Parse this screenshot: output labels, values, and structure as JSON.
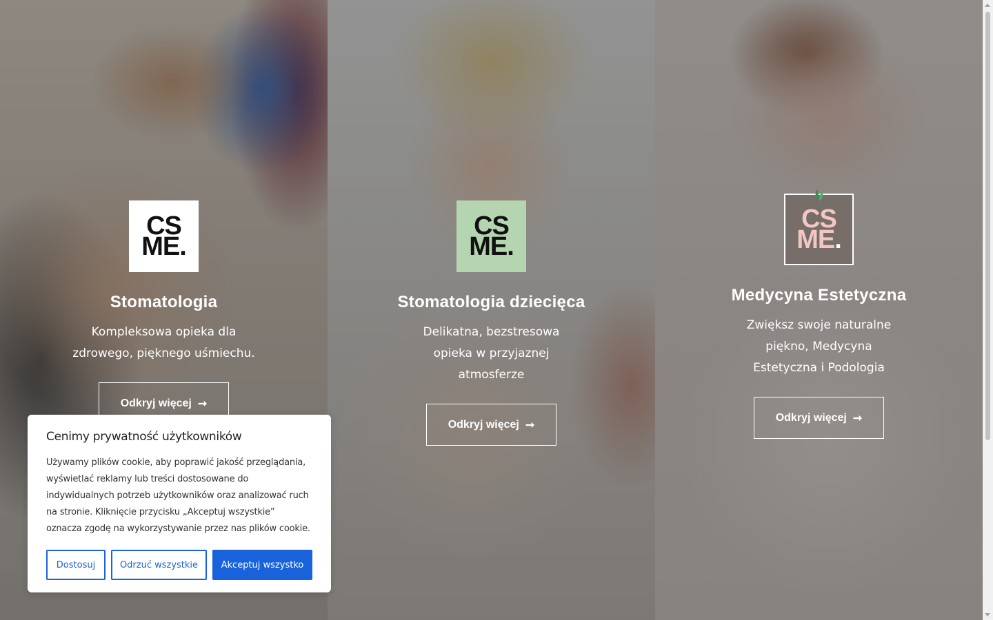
{
  "panels": [
    {
      "logo": {
        "line1": "CS",
        "line2": "ME",
        "dot": ".",
        "style": "white",
        "color": "#ffffff"
      },
      "title": "Stomatologia",
      "description": "Kompleksowa opieka dla zdrowego, pięknego uśmiechu.",
      "button": {
        "label": "Odkryj więcej",
        "icon": "arrow-right-icon"
      }
    },
    {
      "logo": {
        "line1": "CS",
        "line2": "ME",
        "dot": ".",
        "style": "green",
        "color": "#b4d5b0"
      },
      "title": "Stomatologia dziecięca",
      "description": "Delikatna, bezstresowa opieka w przyjaznej atmosferze",
      "button": {
        "label": "Odkryj więcej",
        "icon": "arrow-right-icon"
      }
    },
    {
      "logo": {
        "line1": "CS",
        "line2": "ME",
        "dot": ".",
        "style": "outline-leaf",
        "color": "#f2c7c2"
      },
      "title": "Medycyna Estetyczna",
      "description": "Zwiększ swoje naturalne piękno, Medycyna Estetyczna i Podologia",
      "button": {
        "label": "Odkryj więcej",
        "icon": "arrow-right-icon"
      }
    }
  ],
  "cookie_banner": {
    "title": "Cenimy prywatność użytkowników",
    "text": "Używamy plików cookie, aby poprawić jakość przeglądania, wyświetlać reklamy lub treści dostosowane do indywidualnych potrzeb użytkowników oraz analizować ruch na stronie. Kliknięcie przycisku „Akceptuj wszystkie” oznacza zgodę na wykorzystywanie przez nas plików cookie.",
    "buttons": {
      "customize": "Dostosuj",
      "reject": "Odrzuć wszystkie",
      "accept": "Akceptuj wszystko"
    },
    "accent_color": "#1863dc"
  }
}
